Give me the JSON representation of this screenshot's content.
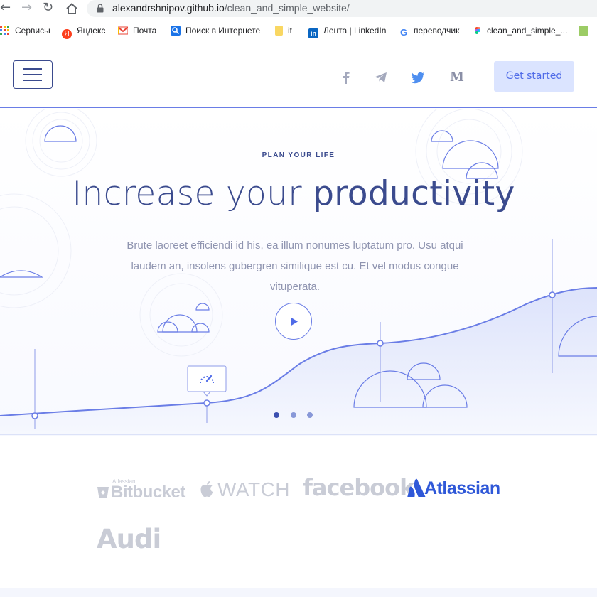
{
  "browser": {
    "url_host": "alexandrshnipov.github.io",
    "url_path": "/clean_and_simple_website/",
    "bookmarks": [
      {
        "label": "Сервисы",
        "icon": "apps-grid-icon"
      },
      {
        "label": "Яндекс",
        "icon": "yandex-icon"
      },
      {
        "label": "Почта",
        "icon": "gmail-icon"
      },
      {
        "label": "Поиск в Интернете",
        "icon": "search-icon"
      },
      {
        "label": "it",
        "icon": "folder-icon"
      },
      {
        "label": "Лента | LinkedIn",
        "icon": "linkedin-icon"
      },
      {
        "label": "переводчик",
        "icon": "google-icon"
      },
      {
        "label": "clean_and_simple_...",
        "icon": "figma-icon"
      }
    ]
  },
  "header": {
    "social": [
      "facebook-icon",
      "telegram-icon",
      "twitter-icon",
      "medium-icon"
    ],
    "cta_label": "Get started"
  },
  "hero": {
    "eyebrow": "PLAN YOUR LIFE",
    "headline_light": "Increase your ",
    "headline_bold": "productivity",
    "body": "Brute laoreet efficiendi id his, ea illum nonumes luptatum pro. Usu atqui laudem an, insolens gubergren similique est cu. Et vel modus congue vituperata.",
    "carousel_dots": 3,
    "active_dot": 0
  },
  "logos": {
    "bitbucket_small": "Atlassian",
    "bitbucket": "Bitbucket",
    "watch": "WATCH",
    "facebook": "facebook",
    "atlassian": "Atlassian",
    "audi": "Audi"
  },
  "colors": {
    "primary": "#3b4b8e",
    "accent": "#6a7de6",
    "cta_bg": "#dbe4ff",
    "cta_text": "#4f6be8",
    "muted": "#8f94b0",
    "logo_gray": "#c9ccd6",
    "atlassian_blue": "#2f58d8"
  }
}
